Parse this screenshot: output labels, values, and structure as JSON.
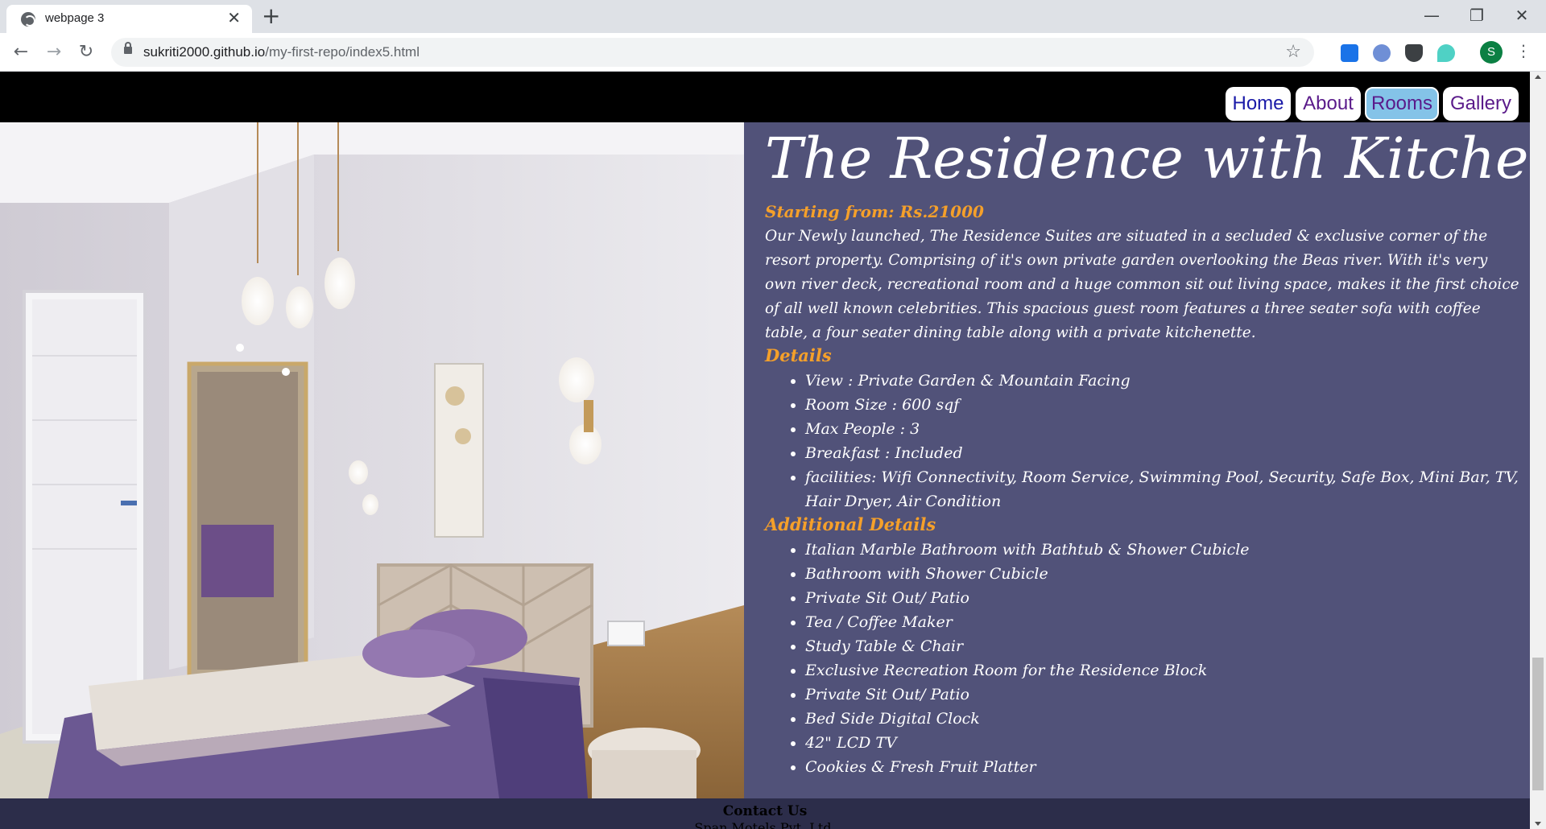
{
  "browser": {
    "tab_title": "webpage 3",
    "new_tab_symbol": "+",
    "close_tab_symbol": "✕",
    "url_host": "sukriti2000.github.io",
    "url_path": "/my-first-repo/index5.html",
    "profile_initial": "S",
    "window_controls": {
      "minimize": "—",
      "maximize": "❐",
      "close": "✕"
    },
    "nav": {
      "back": "←",
      "forward": "→",
      "reload": "↻"
    },
    "bookmark_icon": "☆",
    "menu_icon": "⋮"
  },
  "site_nav": {
    "links": [
      {
        "label": "Home"
      },
      {
        "label": "About"
      },
      {
        "label": "Rooms",
        "active": true
      },
      {
        "label": "Gallery"
      }
    ]
  },
  "room": {
    "title": "The Residence with Kitchenette",
    "price": "Starting from: Rs.21000",
    "description": "Our Newly launched, The Residence Suites are situated in a secluded & exclusive corner of the resort property. Comprising of it's own private garden overlooking the Beas river. With it's very own river deck, recreational room and a huge common sit out living space, makes it the first choice of all well known celebrities. This spacious guest room features a three seater sofa with coffee table, a four seater dining table along with a private kitchenette.",
    "details_heading": "Details",
    "details": [
      "View : Private Garden & Mountain Facing",
      "Room Size : 600 sqf",
      "Max People : 3",
      "Breakfast : Included",
      "facilities: Wifi Connectivity, Room Service, Swimming Pool, Security, Safe Box, Mini Bar, TV, Hair Dryer, Air Condition"
    ],
    "additional_heading": "Additional Details",
    "additional": [
      "Italian Marble Bathroom with Bathtub & Shower Cubicle",
      "Bathroom with Shower Cubicle",
      "Private Sit Out/ Patio",
      "Tea / Coffee Maker",
      "Study Table & Chair",
      "Exclusive Recreation Room for the Residence Block",
      "Private Sit Out/ Patio",
      "Bed Side Digital Clock",
      "42\" LCD TV",
      "Cookies & Fresh Fruit Platter"
    ]
  },
  "footer": {
    "title": "Contact Us",
    "company": "Span Motels Pvt. Ltd."
  },
  "colors": {
    "content_bg": "#515279",
    "accent_orange": "#f5a02a",
    "header_bg": "#000000",
    "footer_bg": "#2c2d4a",
    "active_nav_bg": "#84c3e8"
  }
}
